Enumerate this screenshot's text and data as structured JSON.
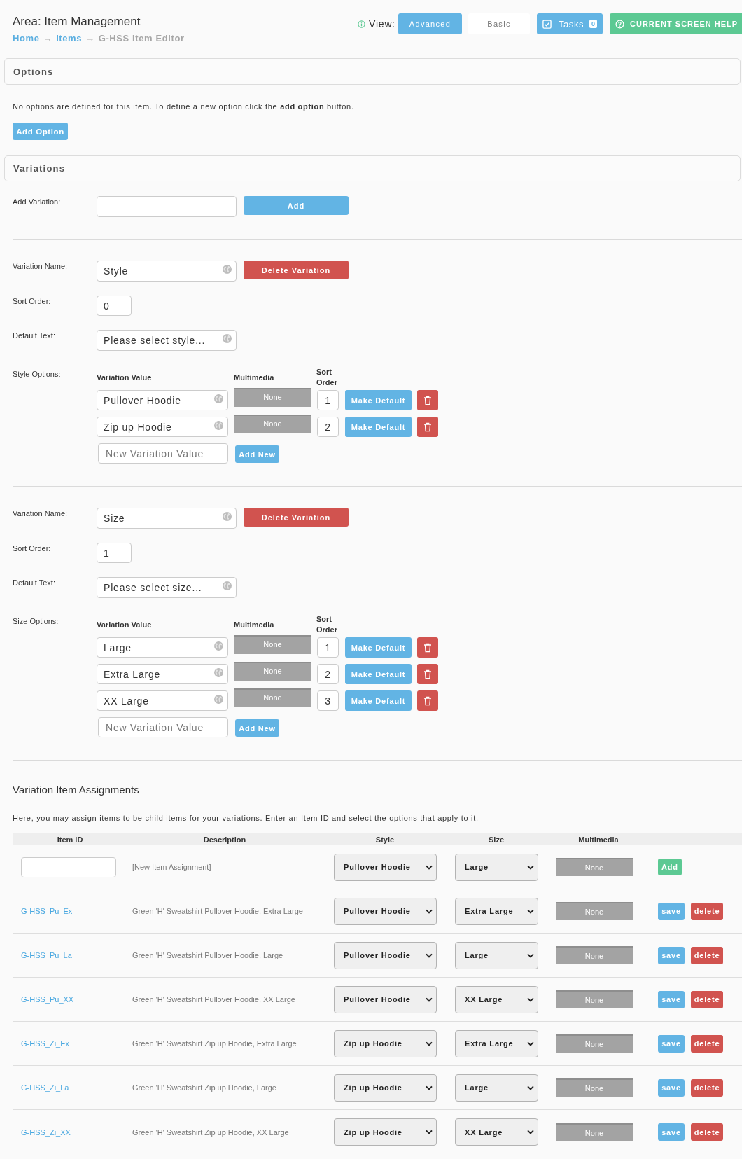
{
  "header": {
    "title": "Area: Item Management",
    "breadcrumbs": [
      {
        "label": "Home",
        "current": false,
        "separator": "→"
      },
      {
        "label": "Items",
        "current": false,
        "separator": "→"
      },
      {
        "label": "G-HSS Item Editor",
        "current": true
      }
    ],
    "view": {
      "label": "View:",
      "options": [
        {
          "label": "Advanced",
          "selected": true
        },
        {
          "label": "Basic",
          "selected": false
        }
      ]
    },
    "tasks": {
      "label": "Tasks",
      "count": "0"
    },
    "help_button": "CURRENT SCREEN HELP"
  },
  "options_section": {
    "title": "Options",
    "message": "No options are defined for this item. To define a new option click the **add option** button.",
    "add_button": "Add Option"
  },
  "variations_section": {
    "title": "Variations",
    "add_label": "Add Variation:",
    "add_button": "Add",
    "variations": [
      {
        "name_label": "Variation Name:",
        "name": "Style",
        "delete_button": "Delete Variation",
        "sort_order_label": "Sort Order:",
        "sort_order": "0",
        "default_text_label": "Default Text:",
        "default_text": "Please select style...",
        "options_label": "Style Options:",
        "columns": [
          "Variation Value",
          "Multimedia",
          "Sort Order"
        ],
        "values": [
          {
            "value": "Pullover Hoodie",
            "multimedia": "None",
            "sort_order": "1",
            "make_default_button": "Make Default"
          },
          {
            "value": "Zip up Hoodie",
            "multimedia": "None",
            "sort_order": "2",
            "make_default_button": "Make Default"
          }
        ],
        "new_value_placeholder": "New Variation Value",
        "add_new_button": "Add New"
      },
      {
        "name_label": "Variation Name:",
        "name": "Size",
        "delete_button": "Delete Variation",
        "sort_order_label": "Sort Order:",
        "sort_order": "1",
        "default_text_label": "Default Text:",
        "default_text": "Please select size...",
        "options_label": "Size Options:",
        "columns": [
          "Variation Value",
          "Multimedia",
          "Sort Order"
        ],
        "values": [
          {
            "value": "Large",
            "multimedia": "None",
            "sort_order": "1",
            "make_default_button": "Make Default"
          },
          {
            "value": "Extra Large",
            "multimedia": "None",
            "sort_order": "2",
            "make_default_button": "Make Default"
          },
          {
            "value": "XX Large",
            "multimedia": "None",
            "sort_order": "3",
            "make_default_button": "Make Default"
          }
        ],
        "new_value_placeholder": "New Variation Value",
        "add_new_button": "Add New"
      }
    ]
  },
  "assignments": {
    "title": "Variation Item Assignments",
    "intro": "Here, you may assign items to be child items for your variations. Enter an Item ID and select the options that apply to it.",
    "columns": [
      "Item ID",
      "Description",
      "Style",
      "Size",
      "Multimedia"
    ],
    "new_row": {
      "description": "[New Item Assignment]",
      "style": "Pullover Hoodie",
      "size": "Large",
      "multimedia": "None",
      "add_button": "Add"
    },
    "rows": [
      {
        "item_id": "G-HSS_Pu_Ex",
        "description": "Green 'H' Sweatshirt Pullover Hoodie, Extra Large",
        "style": "Pullover Hoodie",
        "size": "Extra Large",
        "multimedia": "None",
        "save_button": "save",
        "delete_button": "delete"
      },
      {
        "item_id": "G-HSS_Pu_La",
        "description": "Green 'H' Sweatshirt Pullover Hoodie, Large",
        "style": "Pullover Hoodie",
        "size": "Large",
        "multimedia": "None",
        "save_button": "save",
        "delete_button": "delete"
      },
      {
        "item_id": "G-HSS_Pu_XX",
        "description": "Green 'H' Sweatshirt Pullover Hoodie, XX Large",
        "style": "Pullover Hoodie",
        "size": "XX Large",
        "multimedia": "None",
        "save_button": "save",
        "delete_button": "delete"
      },
      {
        "item_id": "G-HSS_Zi_Ex",
        "description": "Green 'H' Sweatshirt Zip up Hoodie, Extra Large",
        "style": "Zip up Hoodie",
        "size": "Extra Large",
        "multimedia": "None",
        "save_button": "save",
        "delete_button": "delete"
      },
      {
        "item_id": "G-HSS_Zi_La",
        "description": "Green 'H' Sweatshirt Zip up Hoodie, Large",
        "style": "Zip up Hoodie",
        "size": "Large",
        "multimedia": "None",
        "save_button": "save",
        "delete_button": "delete"
      },
      {
        "item_id": "G-HSS_Zi_XX",
        "description": "Green 'H' Sweatshirt Zip up Hoodie, XX Large",
        "style": "Zip up Hoodie",
        "size": "XX Large",
        "multimedia": "None",
        "save_button": "save",
        "delete_button": "delete"
      }
    ]
  }
}
